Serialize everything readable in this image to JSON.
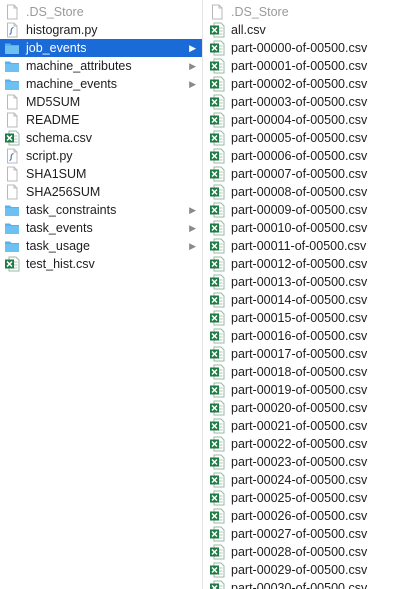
{
  "left_column": {
    "items": [
      {
        "label": ".DS_Store",
        "icon": "blank-doc-icon",
        "dim": true,
        "folder": false
      },
      {
        "label": "histogram.py",
        "icon": "python-script-icon",
        "dim": false,
        "folder": false
      },
      {
        "label": "job_events",
        "icon": "folder-icon",
        "dim": false,
        "folder": true,
        "selected": true
      },
      {
        "label": "machine_attributes",
        "icon": "folder-icon",
        "dim": false,
        "folder": true
      },
      {
        "label": "machine_events",
        "icon": "folder-icon",
        "dim": false,
        "folder": true
      },
      {
        "label": "MD5SUM",
        "icon": "blank-doc-icon",
        "dim": false,
        "folder": false
      },
      {
        "label": "README",
        "icon": "blank-doc-icon",
        "dim": false,
        "folder": false
      },
      {
        "label": "schema.csv",
        "icon": "excel-csv-icon",
        "dim": false,
        "folder": false
      },
      {
        "label": "script.py",
        "icon": "python-script-icon",
        "dim": false,
        "folder": false
      },
      {
        "label": "SHA1SUM",
        "icon": "blank-doc-icon",
        "dim": false,
        "folder": false
      },
      {
        "label": "SHA256SUM",
        "icon": "blank-doc-icon",
        "dim": false,
        "folder": false
      },
      {
        "label": "task_constraints",
        "icon": "folder-icon",
        "dim": false,
        "folder": true
      },
      {
        "label": "task_events",
        "icon": "folder-icon",
        "dim": false,
        "folder": true
      },
      {
        "label": "task_usage",
        "icon": "folder-icon",
        "dim": false,
        "folder": true
      },
      {
        "label": "test_hist.csv",
        "icon": "excel-csv-icon",
        "dim": false,
        "folder": false
      }
    ]
  },
  "right_column": {
    "items": [
      {
        "label": ".DS_Store",
        "icon": "blank-doc-icon",
        "dim": true
      },
      {
        "label": "all.csv",
        "icon": "excel-csv-icon",
        "dim": false
      },
      {
        "label": "part-00000-of-00500.csv",
        "icon": "excel-csv-icon",
        "dim": false
      },
      {
        "label": "part-00001-of-00500.csv",
        "icon": "excel-csv-icon",
        "dim": false
      },
      {
        "label": "part-00002-of-00500.csv",
        "icon": "excel-csv-icon",
        "dim": false
      },
      {
        "label": "part-00003-of-00500.csv",
        "icon": "excel-csv-icon",
        "dim": false
      },
      {
        "label": "part-00004-of-00500.csv",
        "icon": "excel-csv-icon",
        "dim": false
      },
      {
        "label": "part-00005-of-00500.csv",
        "icon": "excel-csv-icon",
        "dim": false
      },
      {
        "label": "part-00006-of-00500.csv",
        "icon": "excel-csv-icon",
        "dim": false
      },
      {
        "label": "part-00007-of-00500.csv",
        "icon": "excel-csv-icon",
        "dim": false
      },
      {
        "label": "part-00008-of-00500.csv",
        "icon": "excel-csv-icon",
        "dim": false
      },
      {
        "label": "part-00009-of-00500.csv",
        "icon": "excel-csv-icon",
        "dim": false
      },
      {
        "label": "part-00010-of-00500.csv",
        "icon": "excel-csv-icon",
        "dim": false
      },
      {
        "label": "part-00011-of-00500.csv",
        "icon": "excel-csv-icon",
        "dim": false
      },
      {
        "label": "part-00012-of-00500.csv",
        "icon": "excel-csv-icon",
        "dim": false
      },
      {
        "label": "part-00013-of-00500.csv",
        "icon": "excel-csv-icon",
        "dim": false
      },
      {
        "label": "part-00014-of-00500.csv",
        "icon": "excel-csv-icon",
        "dim": false
      },
      {
        "label": "part-00015-of-00500.csv",
        "icon": "excel-csv-icon",
        "dim": false
      },
      {
        "label": "part-00016-of-00500.csv",
        "icon": "excel-csv-icon",
        "dim": false
      },
      {
        "label": "part-00017-of-00500.csv",
        "icon": "excel-csv-icon",
        "dim": false
      },
      {
        "label": "part-00018-of-00500.csv",
        "icon": "excel-csv-icon",
        "dim": false
      },
      {
        "label": "part-00019-of-00500.csv",
        "icon": "excel-csv-icon",
        "dim": false
      },
      {
        "label": "part-00020-of-00500.csv",
        "icon": "excel-csv-icon",
        "dim": false
      },
      {
        "label": "part-00021-of-00500.csv",
        "icon": "excel-csv-icon",
        "dim": false
      },
      {
        "label": "part-00022-of-00500.csv",
        "icon": "excel-csv-icon",
        "dim": false
      },
      {
        "label": "part-00023-of-00500.csv",
        "icon": "excel-csv-icon",
        "dim": false
      },
      {
        "label": "part-00024-of-00500.csv",
        "icon": "excel-csv-icon",
        "dim": false
      },
      {
        "label": "part-00025-of-00500.csv",
        "icon": "excel-csv-icon",
        "dim": false
      },
      {
        "label": "part-00026-of-00500.csv",
        "icon": "excel-csv-icon",
        "dim": false
      },
      {
        "label": "part-00027-of-00500.csv",
        "icon": "excel-csv-icon",
        "dim": false
      },
      {
        "label": "part-00028-of-00500.csv",
        "icon": "excel-csv-icon",
        "dim": false
      },
      {
        "label": "part-00029-of-00500.csv",
        "icon": "excel-csv-icon",
        "dim": false
      },
      {
        "label": "part-00030-of-00500.csv",
        "icon": "excel-csv-icon",
        "dim": false
      }
    ]
  },
  "colors": {
    "selection": "#1a6bd8",
    "folder": "#5ab0ea",
    "excel": "#1f7a45",
    "dim_text": "#9a9a9a"
  },
  "chevron_glyph": "▶"
}
